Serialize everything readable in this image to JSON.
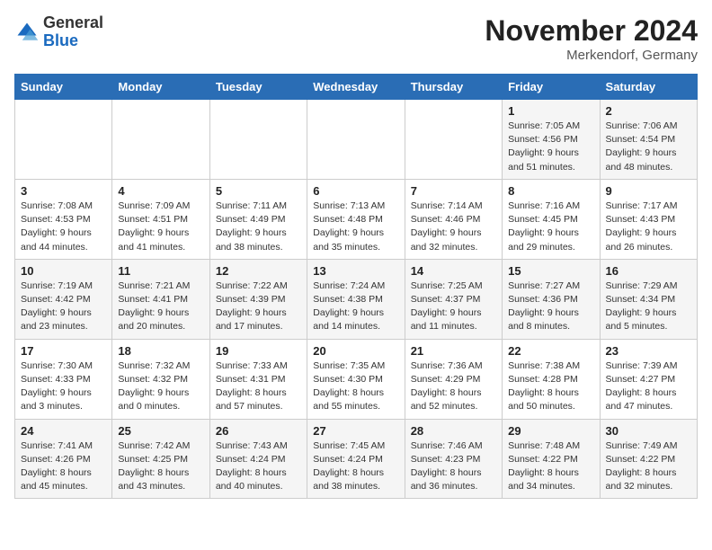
{
  "logo": {
    "general": "General",
    "blue": "Blue"
  },
  "title": "November 2024",
  "location": "Merkendorf, Germany",
  "days_of_week": [
    "Sunday",
    "Monday",
    "Tuesday",
    "Wednesday",
    "Thursday",
    "Friday",
    "Saturday"
  ],
  "weeks": [
    [
      {
        "day": "",
        "content": ""
      },
      {
        "day": "",
        "content": ""
      },
      {
        "day": "",
        "content": ""
      },
      {
        "day": "",
        "content": ""
      },
      {
        "day": "",
        "content": ""
      },
      {
        "day": "1",
        "content": "Sunrise: 7:05 AM\nSunset: 4:56 PM\nDaylight: 9 hours\nand 51 minutes."
      },
      {
        "day": "2",
        "content": "Sunrise: 7:06 AM\nSunset: 4:54 PM\nDaylight: 9 hours\nand 48 minutes."
      }
    ],
    [
      {
        "day": "3",
        "content": "Sunrise: 7:08 AM\nSunset: 4:53 PM\nDaylight: 9 hours\nand 44 minutes."
      },
      {
        "day": "4",
        "content": "Sunrise: 7:09 AM\nSunset: 4:51 PM\nDaylight: 9 hours\nand 41 minutes."
      },
      {
        "day": "5",
        "content": "Sunrise: 7:11 AM\nSunset: 4:49 PM\nDaylight: 9 hours\nand 38 minutes."
      },
      {
        "day": "6",
        "content": "Sunrise: 7:13 AM\nSunset: 4:48 PM\nDaylight: 9 hours\nand 35 minutes."
      },
      {
        "day": "7",
        "content": "Sunrise: 7:14 AM\nSunset: 4:46 PM\nDaylight: 9 hours\nand 32 minutes."
      },
      {
        "day": "8",
        "content": "Sunrise: 7:16 AM\nSunset: 4:45 PM\nDaylight: 9 hours\nand 29 minutes."
      },
      {
        "day": "9",
        "content": "Sunrise: 7:17 AM\nSunset: 4:43 PM\nDaylight: 9 hours\nand 26 minutes."
      }
    ],
    [
      {
        "day": "10",
        "content": "Sunrise: 7:19 AM\nSunset: 4:42 PM\nDaylight: 9 hours\nand 23 minutes."
      },
      {
        "day": "11",
        "content": "Sunrise: 7:21 AM\nSunset: 4:41 PM\nDaylight: 9 hours\nand 20 minutes."
      },
      {
        "day": "12",
        "content": "Sunrise: 7:22 AM\nSunset: 4:39 PM\nDaylight: 9 hours\nand 17 minutes."
      },
      {
        "day": "13",
        "content": "Sunrise: 7:24 AM\nSunset: 4:38 PM\nDaylight: 9 hours\nand 14 minutes."
      },
      {
        "day": "14",
        "content": "Sunrise: 7:25 AM\nSunset: 4:37 PM\nDaylight: 9 hours\nand 11 minutes."
      },
      {
        "day": "15",
        "content": "Sunrise: 7:27 AM\nSunset: 4:36 PM\nDaylight: 9 hours\nand 8 minutes."
      },
      {
        "day": "16",
        "content": "Sunrise: 7:29 AM\nSunset: 4:34 PM\nDaylight: 9 hours\nand 5 minutes."
      }
    ],
    [
      {
        "day": "17",
        "content": "Sunrise: 7:30 AM\nSunset: 4:33 PM\nDaylight: 9 hours\nand 3 minutes."
      },
      {
        "day": "18",
        "content": "Sunrise: 7:32 AM\nSunset: 4:32 PM\nDaylight: 9 hours\nand 0 minutes."
      },
      {
        "day": "19",
        "content": "Sunrise: 7:33 AM\nSunset: 4:31 PM\nDaylight: 8 hours\nand 57 minutes."
      },
      {
        "day": "20",
        "content": "Sunrise: 7:35 AM\nSunset: 4:30 PM\nDaylight: 8 hours\nand 55 minutes."
      },
      {
        "day": "21",
        "content": "Sunrise: 7:36 AM\nSunset: 4:29 PM\nDaylight: 8 hours\nand 52 minutes."
      },
      {
        "day": "22",
        "content": "Sunrise: 7:38 AM\nSunset: 4:28 PM\nDaylight: 8 hours\nand 50 minutes."
      },
      {
        "day": "23",
        "content": "Sunrise: 7:39 AM\nSunset: 4:27 PM\nDaylight: 8 hours\nand 47 minutes."
      }
    ],
    [
      {
        "day": "24",
        "content": "Sunrise: 7:41 AM\nSunset: 4:26 PM\nDaylight: 8 hours\nand 45 minutes."
      },
      {
        "day": "25",
        "content": "Sunrise: 7:42 AM\nSunset: 4:25 PM\nDaylight: 8 hours\nand 43 minutes."
      },
      {
        "day": "26",
        "content": "Sunrise: 7:43 AM\nSunset: 4:24 PM\nDaylight: 8 hours\nand 40 minutes."
      },
      {
        "day": "27",
        "content": "Sunrise: 7:45 AM\nSunset: 4:24 PM\nDaylight: 8 hours\nand 38 minutes."
      },
      {
        "day": "28",
        "content": "Sunrise: 7:46 AM\nSunset: 4:23 PM\nDaylight: 8 hours\nand 36 minutes."
      },
      {
        "day": "29",
        "content": "Sunrise: 7:48 AM\nSunset: 4:22 PM\nDaylight: 8 hours\nand 34 minutes."
      },
      {
        "day": "30",
        "content": "Sunrise: 7:49 AM\nSunset: 4:22 PM\nDaylight: 8 hours\nand 32 minutes."
      }
    ]
  ]
}
